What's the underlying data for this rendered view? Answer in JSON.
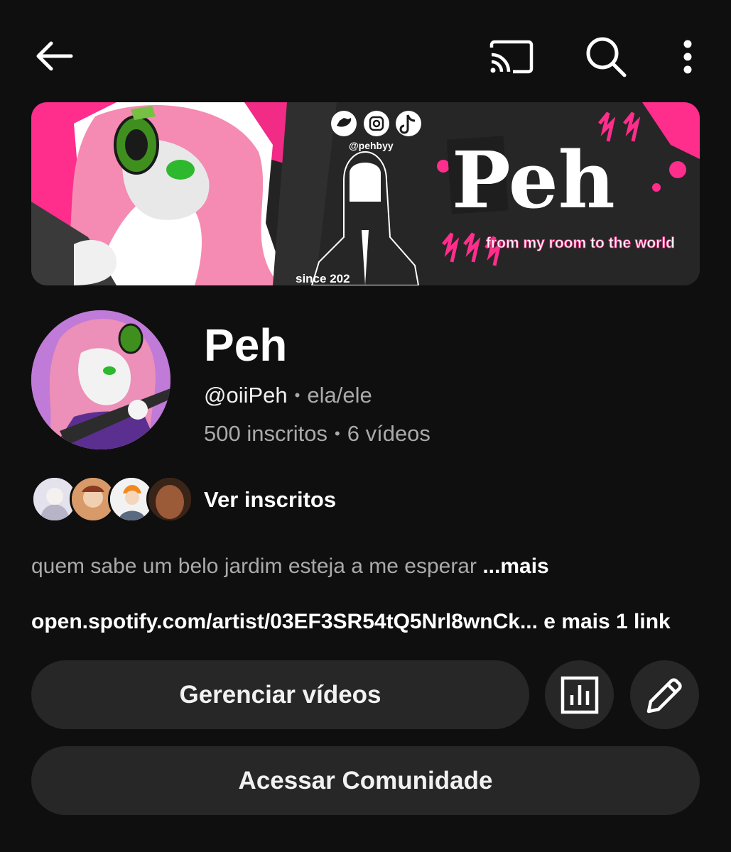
{
  "topbar": {
    "back_icon": "arrow-left-icon",
    "cast_icon": "cast-icon",
    "search_icon": "search-icon",
    "more_icon": "more-vertical-icon"
  },
  "banner": {
    "social_handle": "@pehbyy",
    "logo_text": "Peh",
    "tagline": "from my room to the world",
    "since_text": "since 202"
  },
  "channel": {
    "name": "Peh",
    "handle": "@oiiPeh",
    "pronouns": "ela/ele",
    "subscribers": "500 inscritos",
    "videos": "6 vídeos"
  },
  "subscribers_preview": {
    "label": "Ver inscritos"
  },
  "description": {
    "text": "quem sabe um belo jardim esteja a me esperar",
    "more_label": "...mais"
  },
  "links": {
    "text": "open.spotify.com/artist/03EF3SR54tQ5Nrl8wnCk... e mais 1 link"
  },
  "actions": {
    "manage_videos": "Gerenciar vídeos",
    "analytics_icon": "analytics-icon",
    "edit_icon": "pencil-icon",
    "community": "Acessar Comunidade"
  },
  "colors": {
    "background": "#0f0f0f",
    "button_bg": "#272727",
    "accent_pink": "#ff2d8c",
    "secondary_text": "#aaaaaa"
  }
}
